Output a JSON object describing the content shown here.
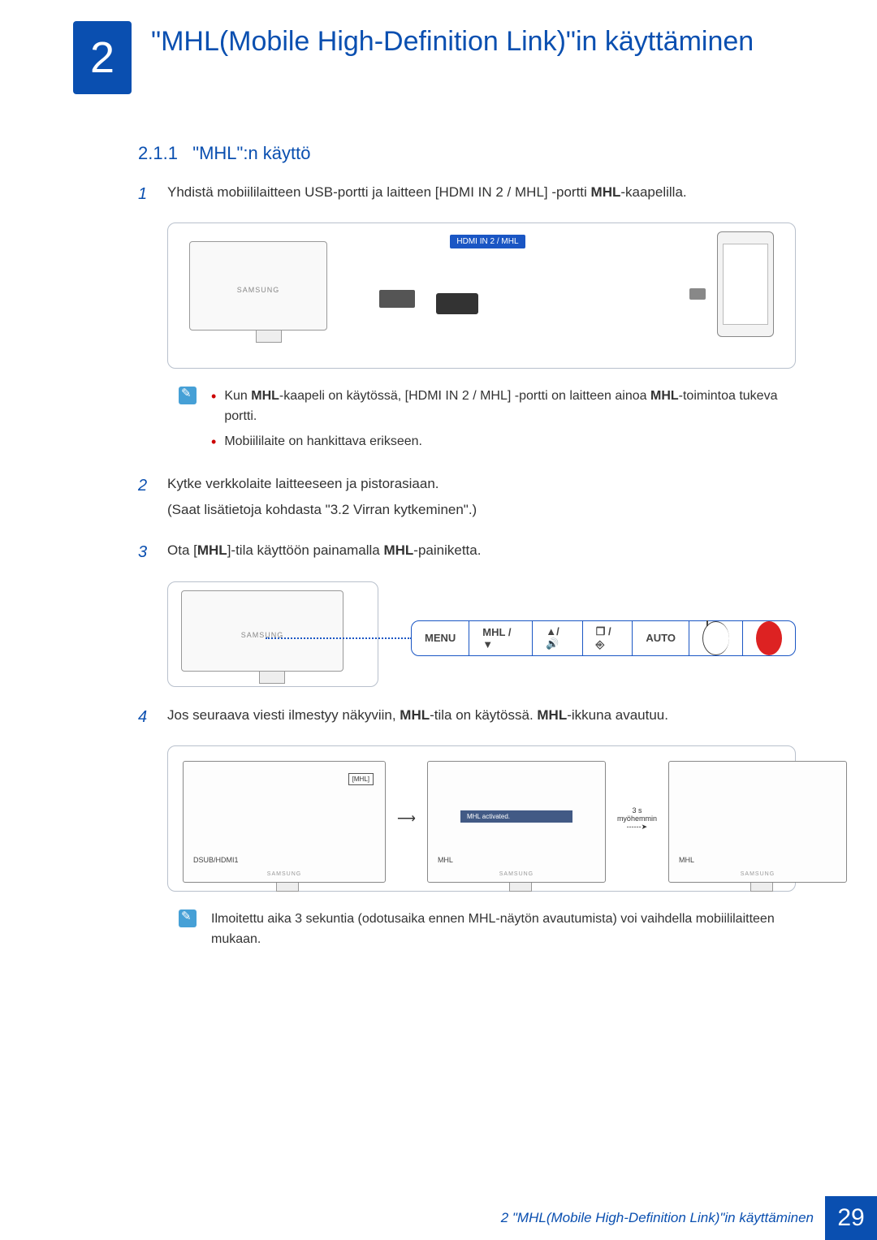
{
  "chapter": {
    "number": "2",
    "title": "\"MHL(Mobile High-Definition Link)\"in käyttäminen"
  },
  "section": {
    "number": "2.1.1",
    "title": "\"MHL\":n käyttö"
  },
  "steps": {
    "s1": {
      "num": "1",
      "text_pre": "Yhdistä mobiililaitteen USB-portti ja laitteen [HDMI IN 2 / MHL] -portti ",
      "bold": "MHL",
      "text_post": "-kaapelilla."
    },
    "s2": {
      "num": "2",
      "line1": "Kytke verkkolaite laitteeseen ja pistorasiaan.",
      "line2": "(Saat lisätietoja kohdasta \"3.2 Virran kytkeminen\".)"
    },
    "s3": {
      "num": "3",
      "pre": "Ota [",
      "b1": "MHL",
      "mid": "]-tila käyttöön painamalla ",
      "b2": "MHL",
      "post": "-painiketta."
    },
    "s4": {
      "num": "4",
      "pre": "Jos seuraava viesti ilmestyy näkyviin, ",
      "b1": "MHL",
      "mid": "-tila on käytössä. ",
      "b2": "MHL",
      "post": "-ikkuna avautuu."
    }
  },
  "illus1": {
    "port_label": "HDMI IN 2 / MHL",
    "brand": "SAMSUNG"
  },
  "note1": {
    "b1_pre": "Kun ",
    "b1_bold1": "MHL",
    "b1_mid": "-kaapeli on käytössä, [HDMI IN 2 / MHL] -portti on laitteen ainoa ",
    "b1_bold2": "MHL",
    "b1_post": "-toimintoa tukeva portti.",
    "b2": "Mobiililaite on hankittava erikseen."
  },
  "osd": {
    "menu": "MENU",
    "mhl": "MHL / ▼",
    "up": "▲/🔊",
    "src": "❐ / ⎆",
    "auto": "AUTO"
  },
  "illus3": {
    "m1_label": "DSUB/HDMI1",
    "m1_box": "[MHL]",
    "arrow1": "⟶",
    "m2_label": "MHL",
    "m2_bar": "MHL activated.",
    "transition": "3 s myöhemmin",
    "arrow2": "------➤",
    "m3_label": "MHL"
  },
  "note2": {
    "text": "Ilmoitettu aika 3 sekuntia (odotusaika ennen MHL-näytön avautumista) voi vaihdella mobiililaitteen mukaan."
  },
  "footer": {
    "text": "2 \"MHL(Mobile High-Definition Link)\"in käyttäminen",
    "page": "29"
  }
}
